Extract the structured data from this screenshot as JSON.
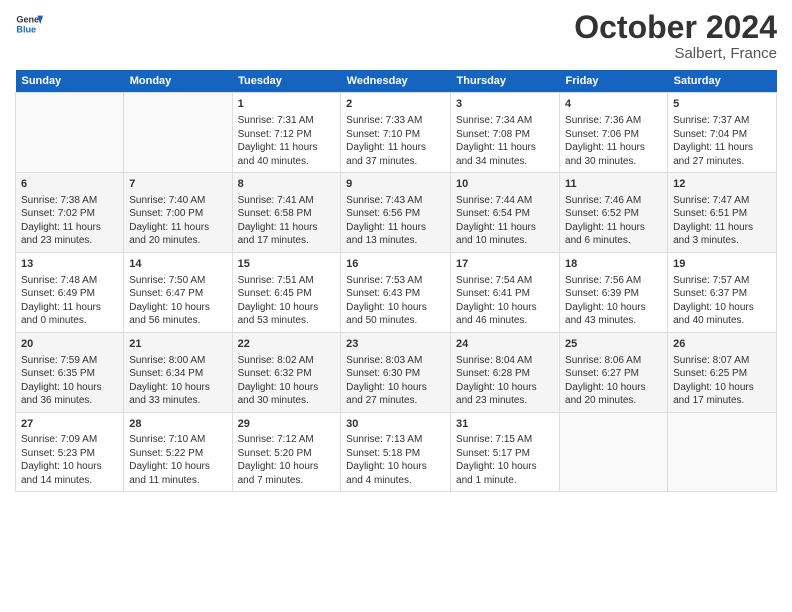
{
  "header": {
    "logo_line1": "General",
    "logo_line2": "Blue",
    "month": "October 2024",
    "location": "Salbert, France"
  },
  "days_of_week": [
    "Sunday",
    "Monday",
    "Tuesday",
    "Wednesday",
    "Thursday",
    "Friday",
    "Saturday"
  ],
  "weeks": [
    [
      {
        "day": "",
        "sunrise": "",
        "sunset": "",
        "daylight": ""
      },
      {
        "day": "",
        "sunrise": "",
        "sunset": "",
        "daylight": ""
      },
      {
        "day": "1",
        "sunrise": "Sunrise: 7:31 AM",
        "sunset": "Sunset: 7:12 PM",
        "daylight": "Daylight: 11 hours and 40 minutes."
      },
      {
        "day": "2",
        "sunrise": "Sunrise: 7:33 AM",
        "sunset": "Sunset: 7:10 PM",
        "daylight": "Daylight: 11 hours and 37 minutes."
      },
      {
        "day": "3",
        "sunrise": "Sunrise: 7:34 AM",
        "sunset": "Sunset: 7:08 PM",
        "daylight": "Daylight: 11 hours and 34 minutes."
      },
      {
        "day": "4",
        "sunrise": "Sunrise: 7:36 AM",
        "sunset": "Sunset: 7:06 PM",
        "daylight": "Daylight: 11 hours and 30 minutes."
      },
      {
        "day": "5",
        "sunrise": "Sunrise: 7:37 AM",
        "sunset": "Sunset: 7:04 PM",
        "daylight": "Daylight: 11 hours and 27 minutes."
      }
    ],
    [
      {
        "day": "6",
        "sunrise": "Sunrise: 7:38 AM",
        "sunset": "Sunset: 7:02 PM",
        "daylight": "Daylight: 11 hours and 23 minutes."
      },
      {
        "day": "7",
        "sunrise": "Sunrise: 7:40 AM",
        "sunset": "Sunset: 7:00 PM",
        "daylight": "Daylight: 11 hours and 20 minutes."
      },
      {
        "day": "8",
        "sunrise": "Sunrise: 7:41 AM",
        "sunset": "Sunset: 6:58 PM",
        "daylight": "Daylight: 11 hours and 17 minutes."
      },
      {
        "day": "9",
        "sunrise": "Sunrise: 7:43 AM",
        "sunset": "Sunset: 6:56 PM",
        "daylight": "Daylight: 11 hours and 13 minutes."
      },
      {
        "day": "10",
        "sunrise": "Sunrise: 7:44 AM",
        "sunset": "Sunset: 6:54 PM",
        "daylight": "Daylight: 11 hours and 10 minutes."
      },
      {
        "day": "11",
        "sunrise": "Sunrise: 7:46 AM",
        "sunset": "Sunset: 6:52 PM",
        "daylight": "Daylight: 11 hours and 6 minutes."
      },
      {
        "day": "12",
        "sunrise": "Sunrise: 7:47 AM",
        "sunset": "Sunset: 6:51 PM",
        "daylight": "Daylight: 11 hours and 3 minutes."
      }
    ],
    [
      {
        "day": "13",
        "sunrise": "Sunrise: 7:48 AM",
        "sunset": "Sunset: 6:49 PM",
        "daylight": "Daylight: 11 hours and 0 minutes."
      },
      {
        "day": "14",
        "sunrise": "Sunrise: 7:50 AM",
        "sunset": "Sunset: 6:47 PM",
        "daylight": "Daylight: 10 hours and 56 minutes."
      },
      {
        "day": "15",
        "sunrise": "Sunrise: 7:51 AM",
        "sunset": "Sunset: 6:45 PM",
        "daylight": "Daylight: 10 hours and 53 minutes."
      },
      {
        "day": "16",
        "sunrise": "Sunrise: 7:53 AM",
        "sunset": "Sunset: 6:43 PM",
        "daylight": "Daylight: 10 hours and 50 minutes."
      },
      {
        "day": "17",
        "sunrise": "Sunrise: 7:54 AM",
        "sunset": "Sunset: 6:41 PM",
        "daylight": "Daylight: 10 hours and 46 minutes."
      },
      {
        "day": "18",
        "sunrise": "Sunrise: 7:56 AM",
        "sunset": "Sunset: 6:39 PM",
        "daylight": "Daylight: 10 hours and 43 minutes."
      },
      {
        "day": "19",
        "sunrise": "Sunrise: 7:57 AM",
        "sunset": "Sunset: 6:37 PM",
        "daylight": "Daylight: 10 hours and 40 minutes."
      }
    ],
    [
      {
        "day": "20",
        "sunrise": "Sunrise: 7:59 AM",
        "sunset": "Sunset: 6:35 PM",
        "daylight": "Daylight: 10 hours and 36 minutes."
      },
      {
        "day": "21",
        "sunrise": "Sunrise: 8:00 AM",
        "sunset": "Sunset: 6:34 PM",
        "daylight": "Daylight: 10 hours and 33 minutes."
      },
      {
        "day": "22",
        "sunrise": "Sunrise: 8:02 AM",
        "sunset": "Sunset: 6:32 PM",
        "daylight": "Daylight: 10 hours and 30 minutes."
      },
      {
        "day": "23",
        "sunrise": "Sunrise: 8:03 AM",
        "sunset": "Sunset: 6:30 PM",
        "daylight": "Daylight: 10 hours and 27 minutes."
      },
      {
        "day": "24",
        "sunrise": "Sunrise: 8:04 AM",
        "sunset": "Sunset: 6:28 PM",
        "daylight": "Daylight: 10 hours and 23 minutes."
      },
      {
        "day": "25",
        "sunrise": "Sunrise: 8:06 AM",
        "sunset": "Sunset: 6:27 PM",
        "daylight": "Daylight: 10 hours and 20 minutes."
      },
      {
        "day": "26",
        "sunrise": "Sunrise: 8:07 AM",
        "sunset": "Sunset: 6:25 PM",
        "daylight": "Daylight: 10 hours and 17 minutes."
      }
    ],
    [
      {
        "day": "27",
        "sunrise": "Sunrise: 7:09 AM",
        "sunset": "Sunset: 5:23 PM",
        "daylight": "Daylight: 10 hours and 14 minutes."
      },
      {
        "day": "28",
        "sunrise": "Sunrise: 7:10 AM",
        "sunset": "Sunset: 5:22 PM",
        "daylight": "Daylight: 10 hours and 11 minutes."
      },
      {
        "day": "29",
        "sunrise": "Sunrise: 7:12 AM",
        "sunset": "Sunset: 5:20 PM",
        "daylight": "Daylight: 10 hours and 7 minutes."
      },
      {
        "day": "30",
        "sunrise": "Sunrise: 7:13 AM",
        "sunset": "Sunset: 5:18 PM",
        "daylight": "Daylight: 10 hours and 4 minutes."
      },
      {
        "day": "31",
        "sunrise": "Sunrise: 7:15 AM",
        "sunset": "Sunset: 5:17 PM",
        "daylight": "Daylight: 10 hours and 1 minute."
      },
      {
        "day": "",
        "sunrise": "",
        "sunset": "",
        "daylight": ""
      },
      {
        "day": "",
        "sunrise": "",
        "sunset": "",
        "daylight": ""
      }
    ]
  ]
}
